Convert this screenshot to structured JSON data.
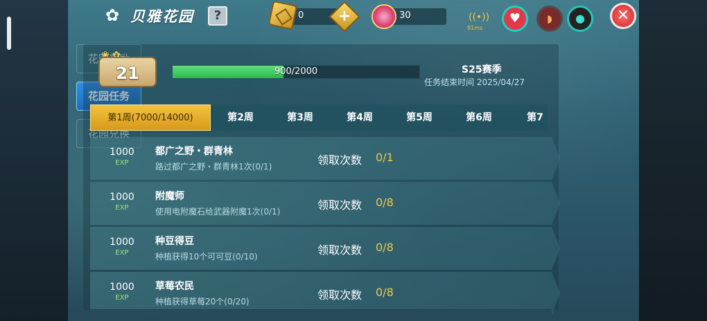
{
  "header": {
    "title": "贝雅花园",
    "help_label": "?",
    "gold_value": "0",
    "plus_label": "+",
    "pink_value": "30",
    "ping": "91ms",
    "close_label": "✕"
  },
  "sidebar": {
    "items": [
      {
        "label": "花园奖励"
      },
      {
        "label": "花园任务"
      },
      {
        "label": "花园兑换"
      }
    ]
  },
  "progress": {
    "level": "21",
    "xp_text": "900/2000",
    "xp_current": 900,
    "xp_max": 2000,
    "season": "S25赛季",
    "season_end": "任务结束时间 2025/04/27"
  },
  "tabs": [
    {
      "label": "第1周(7000/14000)"
    },
    {
      "label": "第2周"
    },
    {
      "label": "第3周"
    },
    {
      "label": "第4周"
    },
    {
      "label": "第5周"
    },
    {
      "label": "第6周"
    },
    {
      "label": "第7"
    }
  ],
  "tasks": [
    {
      "exp": "1000",
      "exp_unit": "EXP",
      "name": "都广之野・群青林",
      "desc": "路过都广之野・群青林1次(0/1)",
      "claim_label": "领取次数",
      "claim_count": "0/1"
    },
    {
      "exp": "1000",
      "exp_unit": "EXP",
      "name": "附魔师",
      "desc": "使用电附魔石给武器附魔1次(0/1)",
      "claim_label": "领取次数",
      "claim_count": "0/8"
    },
    {
      "exp": "1000",
      "exp_unit": "EXP",
      "name": "种豆得豆",
      "desc": "种植获得10个可可豆(0/10)",
      "claim_label": "领取次数",
      "claim_count": "0/8"
    },
    {
      "exp": "1000",
      "exp_unit": "EXP",
      "name": "草莓农民",
      "desc": "种植获得草莓20个(0/20)",
      "claim_label": "领取次数",
      "claim_count": "0/8"
    }
  ]
}
